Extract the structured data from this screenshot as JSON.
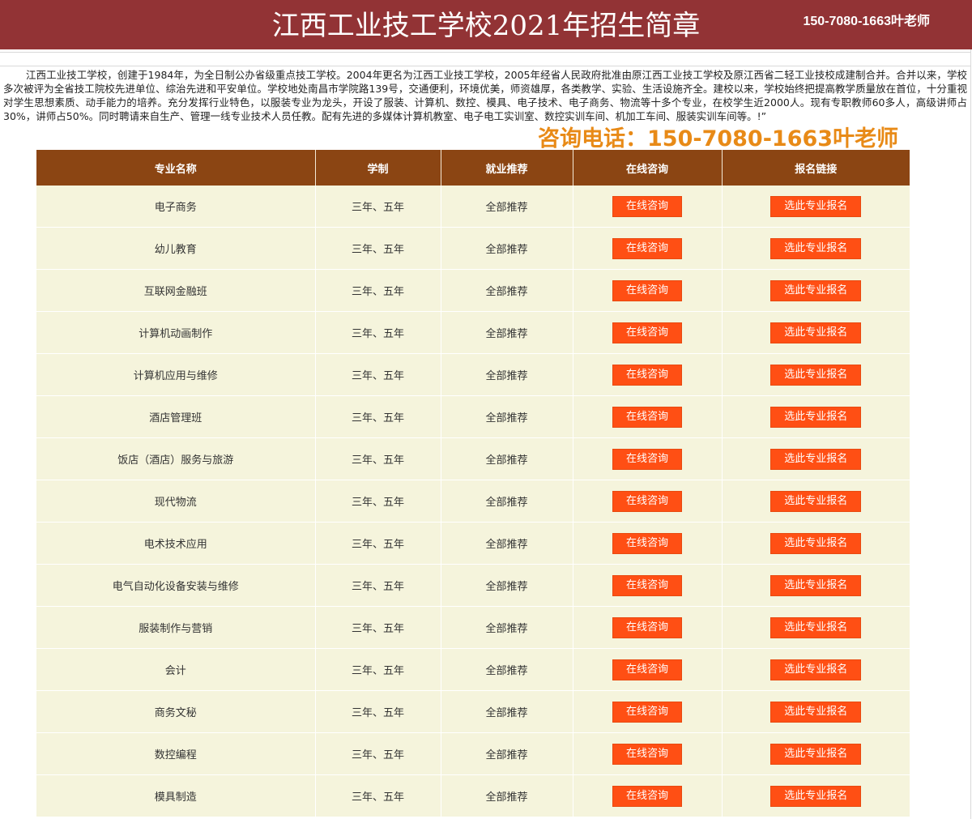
{
  "header": {
    "title": "江西工业技工学校2021年招生简章",
    "phone": "150-7080-1663叶老师"
  },
  "intro": {
    "text": "江西工业技工学校，创建于1984年，为全日制公办省级重点技工学校。2004年更名为江西工业技工学校，2005年经省人民政府批准由原江西工业技工学校及原江西省二轻工业技校成建制合并。合并以来，学校多次被评为全省技工院校先进单位、综治先进和平安单位。学校地处南昌市学院路139号，交通便利，环境优美，师资雄厚，各类教学、实验、生活设施齐全。建校以来，学校始终把提高教学质量放在首位，十分重视对学生思想素质、动手能力的培养。充分发挥行业特色，以服装专业为龙头，开设了服装、计算机、数控、模具、电子技术、电子商务、物流等十多个专业，在校学生近2000人。现有专职教师60多人，高级讲师占30%，讲师占50%。同时聘请来自生产、管理一线专业技术人员任教。配有先进的多媒体计算机教室、电子电工实训室、数控实训车间、机加工车间、服装实训车间等。!”",
    "consult_line": "咨询电话：150-7080-1663叶老师"
  },
  "table": {
    "headers": [
      "专业名称",
      "学制",
      "就业推荐",
      "在线咨询",
      "报名链接"
    ],
    "consult_button": "在线咨询",
    "apply_button": "选此专业报名",
    "rows": [
      {
        "name": "电子商务",
        "duration": "三年、五年",
        "placement": "全部推荐"
      },
      {
        "name": "幼儿教育",
        "duration": "三年、五年",
        "placement": "全部推荐"
      },
      {
        "name": "互联网金融班",
        "duration": "三年、五年",
        "placement": "全部推荐"
      },
      {
        "name": "计算机动画制作",
        "duration": "三年、五年",
        "placement": "全部推荐"
      },
      {
        "name": "计算机应用与维修",
        "duration": "三年、五年",
        "placement": "全部推荐"
      },
      {
        "name": "酒店管理班",
        "duration": "三年、五年",
        "placement": "全部推荐"
      },
      {
        "name": "饭店（酒店）服务与旅游",
        "duration": "三年、五年",
        "placement": "全部推荐"
      },
      {
        "name": "现代物流",
        "duration": "三年、五年",
        "placement": "全部推荐"
      },
      {
        "name": "电术技术应用",
        "duration": "三年、五年",
        "placement": "全部推荐"
      },
      {
        "name": "电气自动化设备安装与维修",
        "duration": "三年、五年",
        "placement": "全部推荐"
      },
      {
        "name": "服装制作与营销",
        "duration": "三年、五年",
        "placement": "全部推荐"
      },
      {
        "name": "会计",
        "duration": "三年、五年",
        "placement": "全部推荐"
      },
      {
        "name": "商务文秘",
        "duration": "三年、五年",
        "placement": "全部推荐"
      },
      {
        "name": "数控编程",
        "duration": "三年、五年",
        "placement": "全部推荐"
      },
      {
        "name": "模具制造",
        "duration": "三年、五年",
        "placement": "全部推荐"
      }
    ]
  },
  "colors": {
    "header_bg": "#923335",
    "table_header_bg": "#8b4513",
    "row_bg": "#f5f4dc",
    "button_bg": "#ff4f14",
    "consult_text": "#e88a17"
  }
}
